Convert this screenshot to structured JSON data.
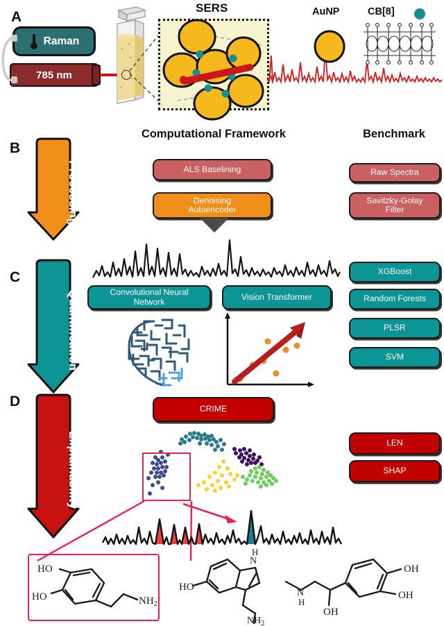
{
  "figure": {
    "panels": [
      "A",
      "B",
      "C",
      "D"
    ],
    "columns": {
      "framework_heading": "Computational Framework",
      "benchmark_heading": "Benchmark"
    }
  },
  "panel_a": {
    "letter": "A",
    "title": "SERS",
    "instrument_label": "Raman",
    "laser_label": "785 nm",
    "aunp_label": "AuNP",
    "cb8_label": "CB[8]",
    "icons": {
      "thermometer": "thermometer-icon",
      "cuvette": "cuvette-icon",
      "aunp": "gold-nanoparticle-icon",
      "cb8": "cucurbituril-molecule-icon"
    },
    "colors": {
      "raman_box": "#2d6e73",
      "laser_box": "#8b2b2b",
      "aunp": "#f5b91e",
      "cb8_dot": "#148f94",
      "spectrum": "#cc2222",
      "zoom_panel_fill": "#f7f4d0"
    }
  },
  "panel_b": {
    "letter": "B",
    "arrow_label": "Processing",
    "arrow_color": "#f0901b",
    "framework_boxes": [
      {
        "label": "ALS Baselining",
        "color": "#cb6060"
      },
      {
        "label": "Denoising\nAutoencoder",
        "color": "#f0901b"
      }
    ],
    "benchmark_boxes": [
      {
        "label": "Raw Spectra",
        "color": "#cb6060"
      },
      {
        "label": "Savitzky-Golay\nFilter",
        "color": "#cb6060"
      }
    ]
  },
  "panel_c": {
    "letter": "C",
    "arrow_label": "Quantification",
    "arrow_color": "#0d9494",
    "framework_boxes": [
      {
        "label": "Convolutional Neural\nNetwork",
        "color": "#0d9494"
      },
      {
        "label": "Vision Transformer",
        "color": "#0d9494"
      }
    ],
    "benchmark_boxes": [
      {
        "label": "XGBoost",
        "color": "#0d9494"
      },
      {
        "label": "Random Forests",
        "color": "#0d9494"
      },
      {
        "label": "PLSR",
        "color": "#0d9494"
      },
      {
        "label": "SVM",
        "color": "#0d9494"
      }
    ],
    "icons": {
      "brain": "circuit-brain-icon",
      "regression": "regression-arrow-plot-icon"
    },
    "colors": {
      "brain_dark": "#2e5a78",
      "brain_light": "#4aa3df",
      "regression_arrow": "#b51f1f",
      "regression_points": "#e8902e"
    }
  },
  "panel_d": {
    "letter": "D",
    "arrow_label": "Explainability",
    "arrow_color": "#c81111",
    "framework_boxes": [
      {
        "label": "CRIME",
        "color": "#c20000"
      }
    ],
    "benchmark_boxes": [
      {
        "label": "LEN",
        "color": "#c20000"
      },
      {
        "label": "SHAP",
        "color": "#c20000"
      }
    ],
    "icons": {
      "scatter": "tsne-cluster-scatter-icon",
      "spectrum": "annotated-spectrum-icon",
      "highlight_box": "zoom-highlight-box"
    },
    "cluster_colors": [
      "#3b4a8c",
      "#277a8e",
      "#3b0f5e",
      "#f5d52c",
      "#6cce59"
    ],
    "spectrum_peak_colors": {
      "attributed_red": "#f04040",
      "attributed_teal": "#17808c"
    }
  },
  "molecules": [
    {
      "name": "dopamine",
      "boxed": true,
      "labels": [
        "HO",
        "HO",
        "NH",
        "2"
      ],
      "display_labels": {
        "oh_top": "HO",
        "oh_bottom": "HO",
        "amine": "NH",
        "amine_sub": "2"
      }
    },
    {
      "name": "serotonin",
      "boxed": false,
      "display_labels": {
        "nh": "H",
        "n": "N",
        "ho": "HO",
        "amine": "NH",
        "amine_sub": "2"
      }
    },
    {
      "name": "adrenaline",
      "boxed": false,
      "display_labels": {
        "oh_top": "OH",
        "oh_bottom": "OH",
        "nh": "N",
        "nh_sub": "H",
        "hydroxyl": "OH"
      }
    }
  ]
}
